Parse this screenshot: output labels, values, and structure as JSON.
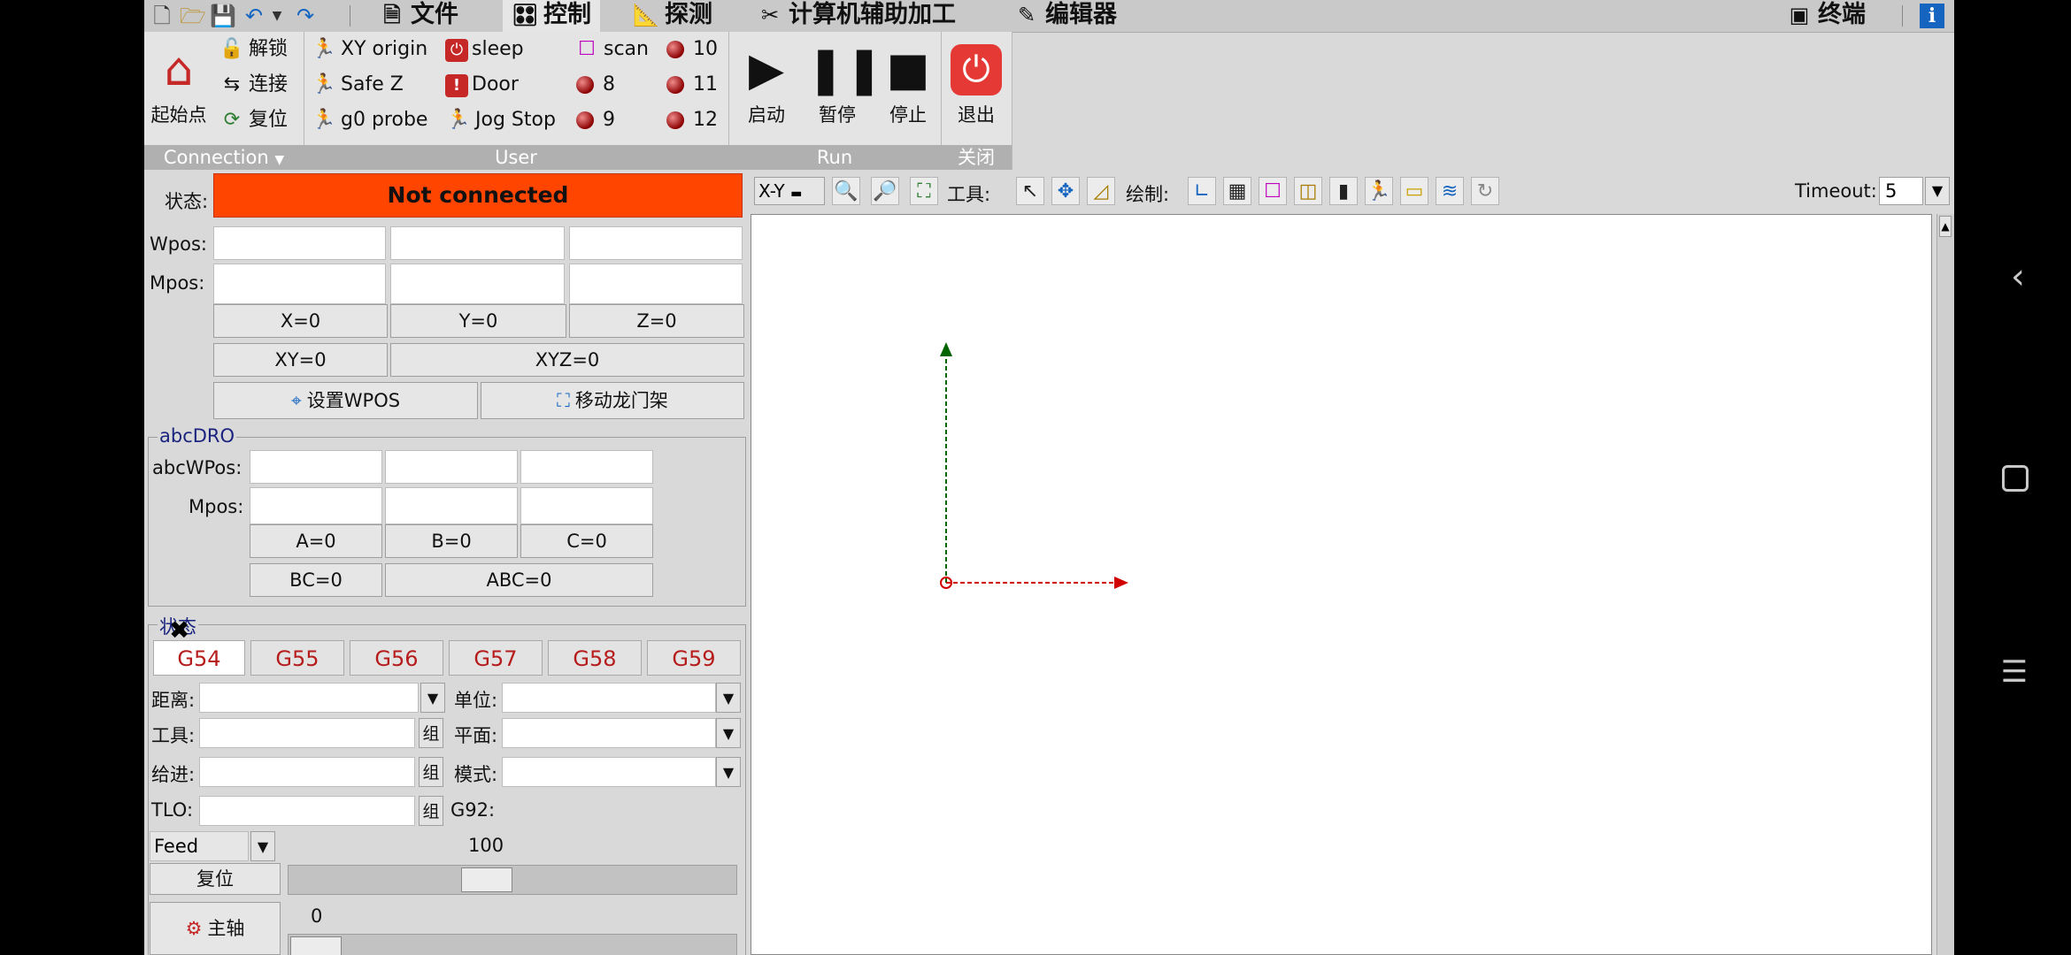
{
  "menubar": {
    "tabs": [
      {
        "label": "文件",
        "icon": "file-icon"
      },
      {
        "label": "控制",
        "icon": "control-icon"
      },
      {
        "label": "探测",
        "icon": "probe-icon"
      },
      {
        "label": "计算机辅助加工",
        "icon": "cam-icon"
      },
      {
        "label": "编辑器",
        "icon": "editor-icon"
      },
      {
        "label": "终端",
        "icon": "terminal-icon"
      }
    ],
    "info_icon": "i"
  },
  "ribbon": {
    "connection": {
      "home_label": "起始点",
      "unlock_label": "解锁",
      "connect_label": "连接",
      "reset_label": "复位",
      "group_label": "Connection"
    },
    "user": {
      "xy_origin": "XY origin",
      "safe_z": "Safe Z",
      "g0_probe": "g0 probe",
      "sleep": "sleep",
      "door": "Door",
      "jog_stop": "Jog Stop",
      "scan": "scan",
      "b8": "8",
      "b9": "9",
      "b10": "10",
      "b11": "11",
      "b12": "12",
      "group_label": "User"
    },
    "run": {
      "start": "启动",
      "pause": "暂停",
      "stop": "停止",
      "group_label": "Run"
    },
    "close": {
      "exit": "退出",
      "group_label": "关闭"
    }
  },
  "state": {
    "label": "状态:",
    "value": "Not connected",
    "color": "#ff4500"
  },
  "dro": {
    "wpos_label": "Wpos:",
    "mpos_label": "Mpos:",
    "x0": "X=0",
    "y0": "Y=0",
    "z0": "Z=0",
    "xy0": "XY=0",
    "xyz0": "XYZ=0",
    "set_wpos": "设置WPOS",
    "move_gantry": "移动龙门架"
  },
  "abcdro": {
    "title": "abcDRO",
    "abcwpos_label": "abcWPos:",
    "mpos_label": "Mpos:",
    "a0": "A=0",
    "b0": "B=0",
    "c0": "C=0",
    "bc0": "BC=0",
    "abc0": "ABC=0"
  },
  "gstate": {
    "title": "状态",
    "tabs": [
      "G54",
      "G55",
      "G56",
      "G57",
      "G58",
      "G59"
    ],
    "distance_label": "距离:",
    "units_label": "单位:",
    "tool_label": "工具:",
    "plane_label": "平面:",
    "feed_label": "给进:",
    "mode_label": "模式:",
    "tlo_label": "TLO:",
    "g92_label": "G92:",
    "set_btn": "组"
  },
  "override": {
    "feed_select": "Feed",
    "feed_value": "100",
    "reset_label": "复位",
    "spindle_label": "主轴",
    "spindle_value": "0"
  },
  "canvas_toolbar": {
    "view_select": "X-Y",
    "tools_label": "工具:",
    "draw_label": "绘制:",
    "timeout_label": "Timeout:",
    "timeout_value": "5"
  }
}
